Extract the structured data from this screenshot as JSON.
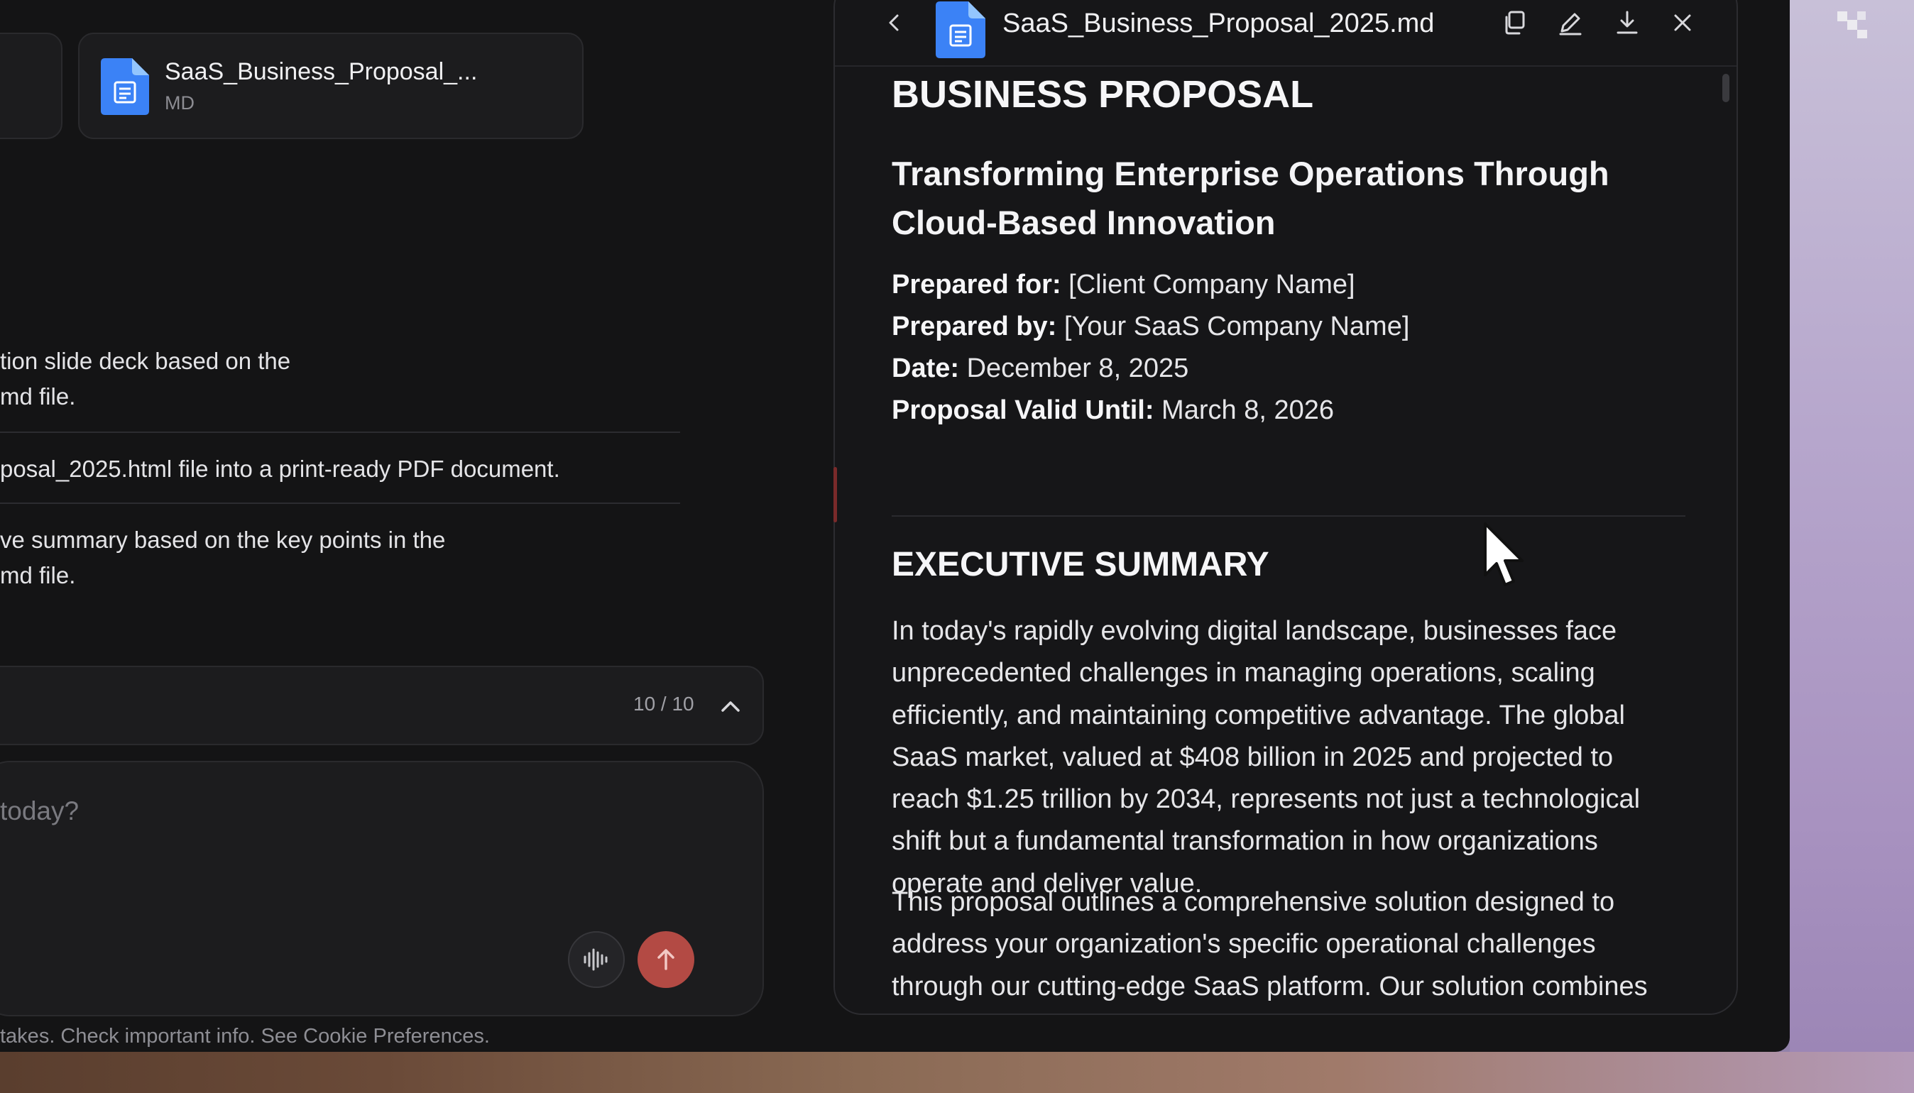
{
  "chat": {
    "attachment": {
      "name": "SaaS_Business_Proposal_...",
      "type": "MD"
    },
    "suggestions": [
      {
        "lines": [
          "tion slide deck based on the",
          "md file."
        ]
      },
      {
        "lines": [
          "posal_2025.html file into a print-ready PDF document."
        ]
      },
      {
        "lines": [
          "ve summary based on the key points in the",
          "md file."
        ]
      }
    ],
    "counter": "10 / 10",
    "input_placeholder": "today?",
    "disclaimer": "takes. Check important info. See Cookie Preferences."
  },
  "panel": {
    "title": "SaaS_Business_Proposal_2025.md",
    "icons": {
      "back": "chevron-left-icon",
      "copy": "copy-icon",
      "edit": "pencil-icon",
      "download": "download-icon",
      "close": "close-icon"
    },
    "document": {
      "h1": "BUSINESS PROPOSAL",
      "h2": "Transforming Enterprise Operations Through Cloud-Based Innovation",
      "meta": [
        {
          "label": "Prepared for:",
          "value": " [Client Company Name]"
        },
        {
          "label": "Prepared by:",
          "value": " [Your SaaS Company Name]"
        },
        {
          "label": "Date:",
          "value": " December 8, 2025"
        },
        {
          "label": "Proposal Valid Until:",
          "value": " March 8, 2026"
        }
      ],
      "section_heading": "EXECUTIVE SUMMARY",
      "paragraph1": "In today's rapidly evolving digital landscape, businesses face unprecedented challenges in managing operations, scaling efficiently, and maintaining competitive advantage. The global SaaS market, valued at $408 billion in 2025 and projected to reach $1.25 trillion by 2034, represents not just a technological shift but a fundamental transformation in how organizations operate and deliver value.",
      "paragraph2": "This proposal outlines a comprehensive solution designed to address your organization's specific operational challenges through our cutting-edge SaaS platform. Our solution combines proven enterprise-grade capabilities with innovative"
    }
  },
  "colors": {
    "doc_icon": "#3b82f6",
    "send_button": "#b34a44",
    "app_background": "#141415"
  }
}
